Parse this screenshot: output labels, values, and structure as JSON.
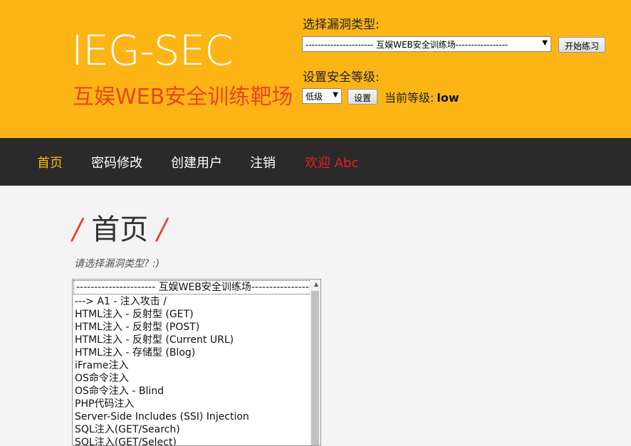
{
  "header": {
    "logo": "IEG-SEC",
    "subtitle": "互娱WEB安全训练靶场",
    "vuln_type_label": "选择漏洞类型:",
    "vuln_select_value": "---------------------- 互娱WEB安全训练场-----------------",
    "start_button": "开始练习",
    "security_label": "设置安全等级:",
    "level_select_value": "低级",
    "set_button": "设置",
    "current_level_label": "当前等级:",
    "current_level_value": "low"
  },
  "nav": {
    "items": [
      {
        "label": "首页"
      },
      {
        "label": "密码修改"
      },
      {
        "label": "创建用户"
      },
      {
        "label": "注销"
      },
      {
        "label": "欢迎 Abc"
      }
    ]
  },
  "main": {
    "title": "首页",
    "slash": "/",
    "prompt": "请选择漏洞类型? :)",
    "list_items": [
      "---------------------- 互娱WEB安全训练场-----------------",
      "---> A1 - 注入攻击 /",
      "HTML注入 - 反射型 (GET)",
      "HTML注入 - 反射型 (POST)",
      "HTML注入 - 反射型 (Current URL)",
      "HTML注入 - 存储型 (Blog)",
      "iFrame注入",
      "OS命令注入",
      "OS命令注入 - Blind",
      "PHP代码注入",
      "Server-Side Includes (SSI) Injection",
      "SQL注入(GET/Search)",
      "SQL注入(GET/Select)"
    ]
  },
  "colors": {
    "header_bg": "#fdb515",
    "nav_bg": "#2a2a2a",
    "accent": "#e8451e"
  }
}
